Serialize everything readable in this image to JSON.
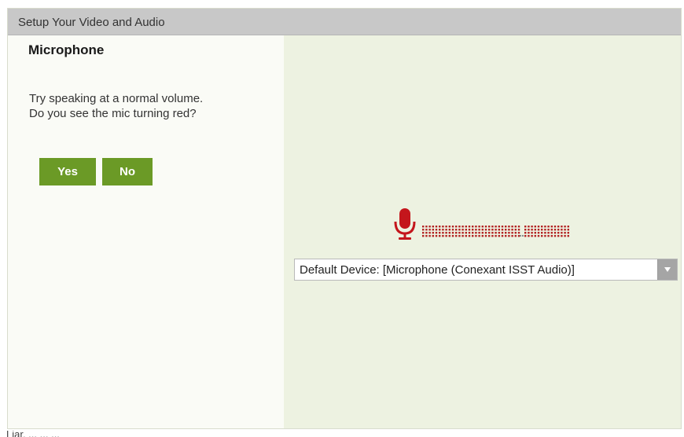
{
  "dialog": {
    "title": "Setup Your Video and Audio"
  },
  "microphone": {
    "heading": "Microphone",
    "instruction_line1": "Try speaking at a normal volume.",
    "instruction_line2": "Do you see the mic turning red?",
    "yes_label": "Yes",
    "no_label": "No",
    "mic_icon": "microphone-icon",
    "mic_color": "#c4161c",
    "level_active_color": "#b22222",
    "device_selected": "Default Device: [Microphone (Conexant ISST Audio)]",
    "dropdown_icon": "chevron-down-icon"
  },
  "colors": {
    "button_green": "#6b9a26",
    "titlebar_gray": "#c8c8c8",
    "panel_green": "#edf2e1"
  },
  "background": {
    "partial_text": "Liar, ... ... ..."
  }
}
